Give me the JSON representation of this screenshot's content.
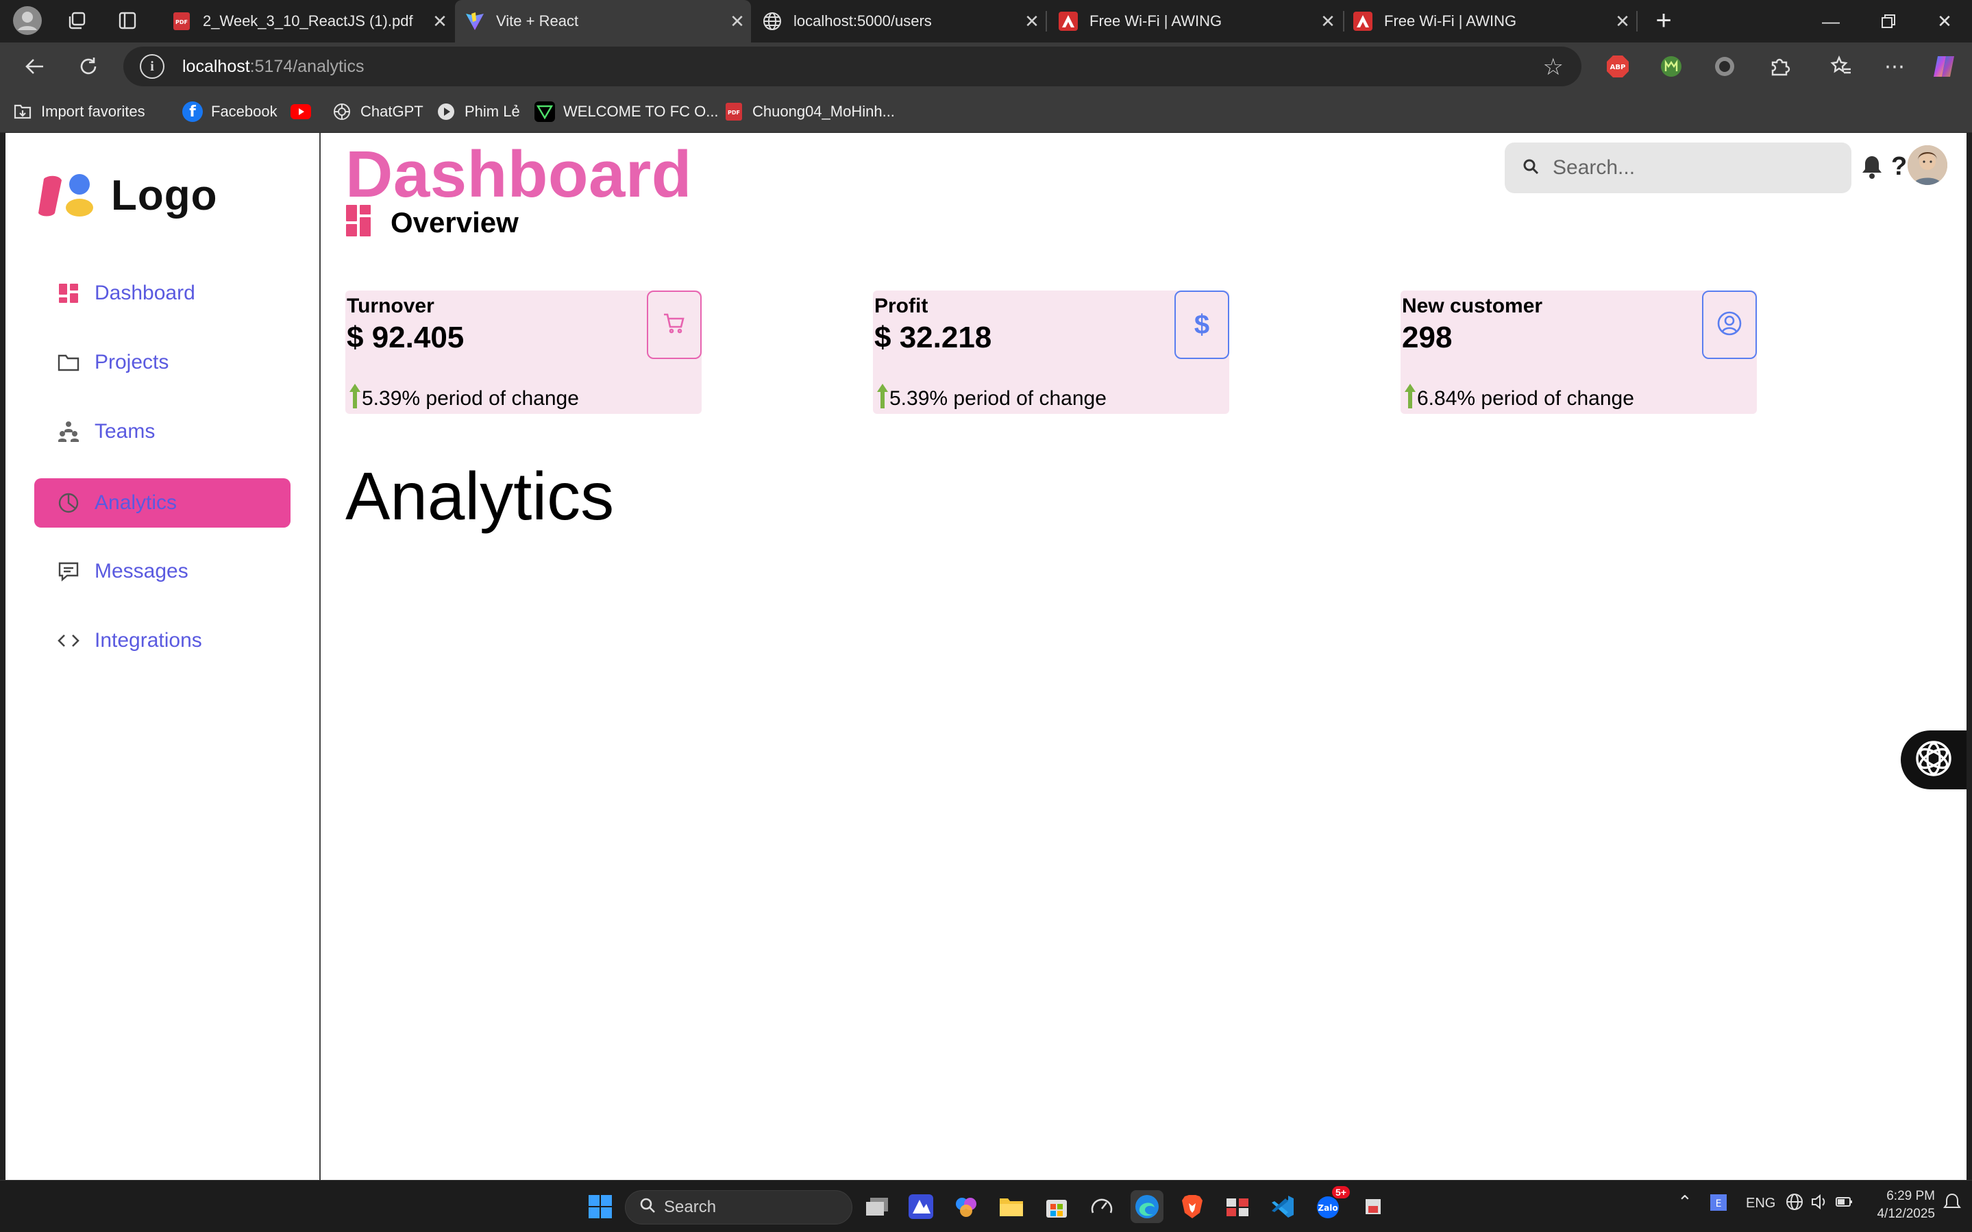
{
  "browser": {
    "tabs": [
      {
        "title": "2_Week_3_10_ReactJS (1).pdf",
        "icon": "pdf-icon"
      },
      {
        "title": "Vite + React",
        "icon": "vite-icon"
      },
      {
        "title": "localhost:5000/users",
        "icon": "globe-icon"
      },
      {
        "title": "Free Wi-Fi | AWING",
        "icon": "awing-icon"
      },
      {
        "title": "Free Wi-Fi | AWING",
        "icon": "awing-icon"
      }
    ],
    "active_tab_index": 1,
    "url_host": "localhost",
    "url_path": ":5174/analytics",
    "bookmarks": [
      {
        "label": "Import favorites"
      },
      {
        "label": "Facebook"
      },
      {
        "label": ""
      },
      {
        "label": "ChatGPT"
      },
      {
        "label": "Phim Lẻ"
      },
      {
        "label": "WELCOME TO FC O..."
      },
      {
        "label": "Chuong04_MoHinh..."
      }
    ],
    "extensions": {
      "abp": "ABP"
    }
  },
  "app": {
    "logo_text": "Logo",
    "nav": [
      {
        "label": "Dashboard",
        "icon": "dashboard-grid-icon"
      },
      {
        "label": "Projects",
        "icon": "folder-icon"
      },
      {
        "label": "Teams",
        "icon": "teams-icon"
      },
      {
        "label": "Analytics",
        "icon": "pie-chart-icon",
        "active": true
      },
      {
        "label": "Messages",
        "icon": "message-icon"
      },
      {
        "label": "Integrations",
        "icon": "code-icon"
      }
    ],
    "header": {
      "title": "Dashboard",
      "section": "Overview",
      "search_placeholder": "Search...",
      "help": "?"
    },
    "cards": [
      {
        "label": "Turnover",
        "value": "$ 92.405",
        "change": "5.39% period of change",
        "icon": "cart-icon",
        "accent": "#e764b0"
      },
      {
        "label": "Profit",
        "value": "$ 32.218",
        "change": "5.39% period of change",
        "icon": "dollar-icon",
        "accent": "#5a7ef0"
      },
      {
        "label": "New customer",
        "value": "298",
        "change": "6.84% period of change",
        "icon": "user-circle-icon",
        "accent": "#5a7ef0"
      }
    ],
    "page_heading": "Analytics"
  },
  "taskbar": {
    "search_label": "Search",
    "lang": "ENG",
    "time": "6:29 PM",
    "date": "4/12/2025",
    "badge": "5+"
  },
  "colors": {
    "brand_pink": "#e764b0",
    "active_nav": "#e8469a",
    "nav_text": "#5a5ae0",
    "card_bg": "#f8e6ef"
  }
}
